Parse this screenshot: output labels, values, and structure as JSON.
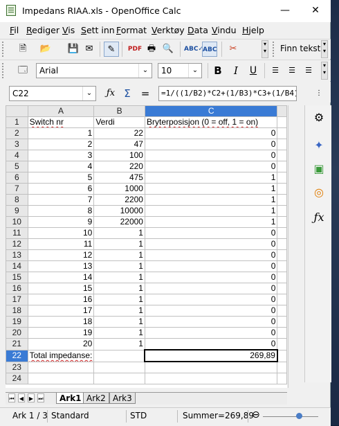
{
  "window": {
    "title": "Impedans RIAA.xls - OpenOffice Calc",
    "minimize": "—",
    "close": "✕"
  },
  "menu": [
    "Fil",
    "Rediger",
    "Vis",
    "Sett inn",
    "Format",
    "Verktøy",
    "Data",
    "Vindu",
    "Hjelp"
  ],
  "toolbar": {
    "find_label": "Finn tekst"
  },
  "format": {
    "font": "Arial",
    "size": "10",
    "bold": "B",
    "italic": "I",
    "underline": "U"
  },
  "formula": {
    "cell_ref": "C22",
    "fx": "ƒx",
    "sum": "Σ",
    "equals": "=",
    "content": "=1/((1/B2)*C2+(1/B3)*C3+(1/B4)*C4+"
  },
  "grid": {
    "columns": [
      "A",
      "B",
      "C"
    ],
    "rows": [
      {
        "n": "1",
        "a": "Switch nr",
        "b": "Verdi",
        "c": "Bryterposisjon (0 = off, 1 = on)"
      },
      {
        "n": "2",
        "a": "1",
        "b": "22",
        "c": "0"
      },
      {
        "n": "3",
        "a": "2",
        "b": "47",
        "c": "0"
      },
      {
        "n": "4",
        "a": "3",
        "b": "100",
        "c": "0"
      },
      {
        "n": "5",
        "a": "4",
        "b": "220",
        "c": "0"
      },
      {
        "n": "6",
        "a": "5",
        "b": "475",
        "c": "1"
      },
      {
        "n": "7",
        "a": "6",
        "b": "1000",
        "c": "1"
      },
      {
        "n": "8",
        "a": "7",
        "b": "2200",
        "c": "1"
      },
      {
        "n": "9",
        "a": "8",
        "b": "10000",
        "c": "1"
      },
      {
        "n": "10",
        "a": "9",
        "b": "22000",
        "c": "1"
      },
      {
        "n": "11",
        "a": "10",
        "b": "1",
        "c": "0"
      },
      {
        "n": "12",
        "a": "11",
        "b": "1",
        "c": "0"
      },
      {
        "n": "13",
        "a": "12",
        "b": "1",
        "c": "0"
      },
      {
        "n": "14",
        "a": "13",
        "b": "1",
        "c": "0"
      },
      {
        "n": "15",
        "a": "14",
        "b": "1",
        "c": "0"
      },
      {
        "n": "16",
        "a": "15",
        "b": "1",
        "c": "0"
      },
      {
        "n": "17",
        "a": "16",
        "b": "1",
        "c": "0"
      },
      {
        "n": "18",
        "a": "17",
        "b": "1",
        "c": "0"
      },
      {
        "n": "19",
        "a": "18",
        "b": "1",
        "c": "0"
      },
      {
        "n": "20",
        "a": "19",
        "b": "1",
        "c": "0"
      },
      {
        "n": "21",
        "a": "20",
        "b": "1",
        "c": "0"
      },
      {
        "n": "22",
        "a": "Total impedanse:",
        "b": "",
        "c": "269,89"
      },
      {
        "n": "23",
        "a": "",
        "b": "",
        "c": ""
      },
      {
        "n": "24",
        "a": "",
        "b": "",
        "c": ""
      }
    ]
  },
  "tabs": [
    "Ark1",
    "Ark2",
    "Ark3"
  ],
  "status": {
    "sheet": "Ark 1 / 3",
    "style": "Standard",
    "mode": "STD",
    "sum": "Summer=269,89",
    "zoom_minus": "⊖"
  },
  "colors": {
    "selected_header": "#3a7bd5",
    "cursor_border": "#000000"
  }
}
